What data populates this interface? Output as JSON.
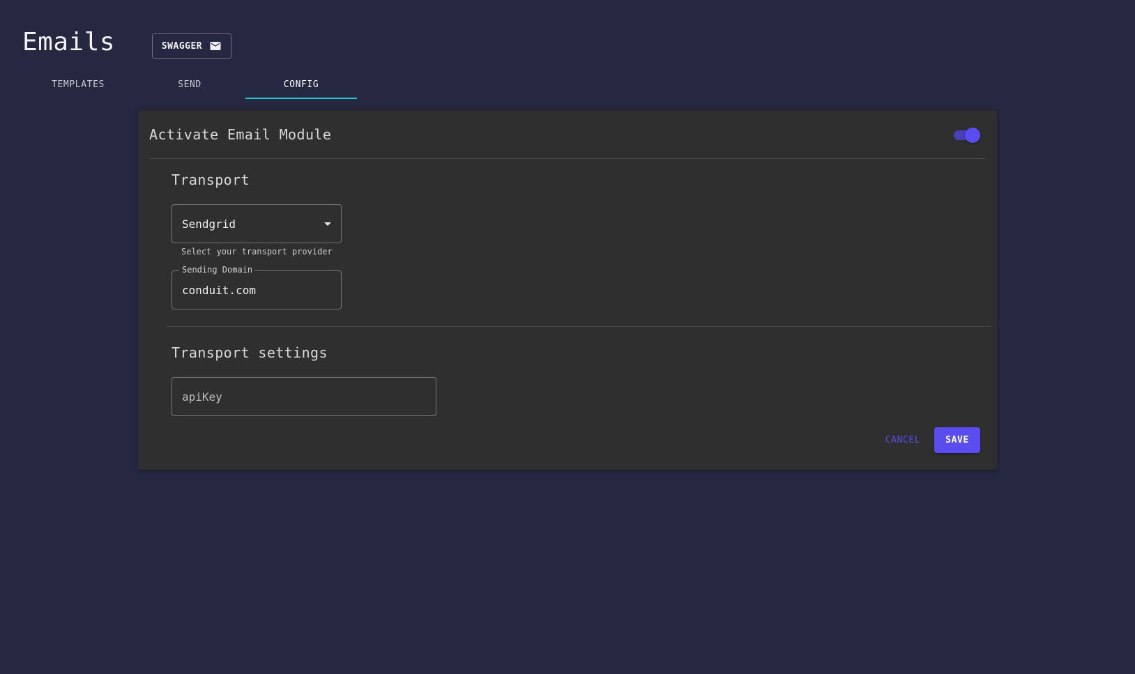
{
  "header": {
    "title": "Emails",
    "swagger_label": "SWAGGER",
    "swagger_icon": "mail-icon"
  },
  "tabs": [
    {
      "label": "TEMPLATES",
      "active": false
    },
    {
      "label": "SEND",
      "active": false
    },
    {
      "label": "CONFIG",
      "active": true
    }
  ],
  "config": {
    "activate_label": "Activate Email Module",
    "module_active": true,
    "transport": {
      "section_title": "Transport",
      "selected": "Sendgrid",
      "helper": "Select your transport provider",
      "sending_domain_label": "Sending Domain",
      "sending_domain_value": "conduit.com"
    },
    "transport_settings": {
      "section_title": "Transport settings",
      "api_key_placeholder": "apiKey",
      "api_key_value": ""
    },
    "actions": {
      "cancel_label": "CANCEL",
      "save_label": "SAVE"
    }
  },
  "colors": {
    "background": "#262841",
    "card": "#2f2f2f",
    "accent": "#5b4cf0",
    "tab_indicator": "#26c6c6"
  }
}
